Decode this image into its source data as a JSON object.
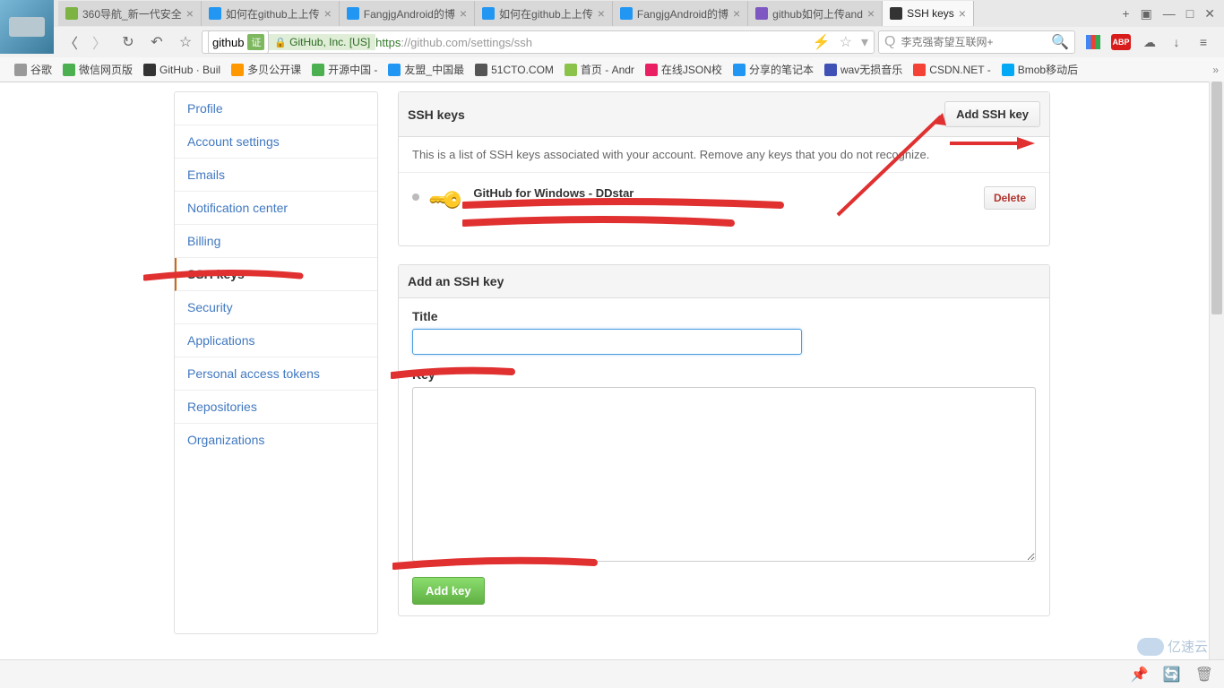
{
  "tabs": [
    {
      "label": "360导航_新一代安全",
      "color": "#7cb342"
    },
    {
      "label": "如何在github上上传",
      "color": "#2196f3"
    },
    {
      "label": "FangjgAndroid的博",
      "color": "#2196f3"
    },
    {
      "label": "如何在github上上传",
      "color": "#2196f3"
    },
    {
      "label": "FangjgAndroid的博",
      "color": "#2196f3"
    },
    {
      "label": "github如何上传and",
      "color": "#7e57c2"
    },
    {
      "label": "SSH keys",
      "color": "#333",
      "active": true
    }
  ],
  "url": {
    "badge": "github",
    "identity": "GitHub, Inc. [US]",
    "scheme": "https",
    "rest": "://github.com/settings/ssh"
  },
  "search_placeholder": "李克强寄望互联网+",
  "bookmarks": [
    {
      "label": "谷歌",
      "color": "#999"
    },
    {
      "label": "微信网页版",
      "color": "#4caf50"
    },
    {
      "label": "GitHub · Buil",
      "color": "#333"
    },
    {
      "label": "多贝公开课",
      "color": "#ff9800"
    },
    {
      "label": "开源中国 -",
      "color": "#4caf50"
    },
    {
      "label": "友盟_中国最",
      "color": "#2196f3"
    },
    {
      "label": "51CTO.COM",
      "color": "#555"
    },
    {
      "label": "首页 - Andr",
      "color": "#8bc34a"
    },
    {
      "label": "在线JSON校",
      "color": "#e91e63"
    },
    {
      "label": "分享的笔记本",
      "color": "#2196f3"
    },
    {
      "label": "wav无损音乐",
      "color": "#3f51b5"
    },
    {
      "label": "CSDN.NET -",
      "color": "#f44336"
    },
    {
      "label": "Bmob移动后",
      "color": "#03a9f4"
    }
  ],
  "sidebar": {
    "items": [
      {
        "label": "Profile"
      },
      {
        "label": "Account settings"
      },
      {
        "label": "Emails"
      },
      {
        "label": "Notification center"
      },
      {
        "label": "Billing"
      },
      {
        "label": "SSH keys",
        "current": true
      },
      {
        "label": "Security"
      },
      {
        "label": "Applications"
      },
      {
        "label": "Personal access tokens"
      },
      {
        "label": "Repositories"
      },
      {
        "label": "Organizations"
      }
    ]
  },
  "ssh_panel": {
    "heading": "SSH keys",
    "add_button": "Add SSH key",
    "description": "This is a list of SSH keys associated with your account. Remove any keys that you do not recognize.",
    "entry_title": "GitHub for Windows - DDstar",
    "delete": "Delete"
  },
  "add_panel": {
    "heading": "Add an SSH key",
    "title_label": "Title",
    "key_label": "Key",
    "submit": "Add key"
  },
  "watermark": "亿速云"
}
